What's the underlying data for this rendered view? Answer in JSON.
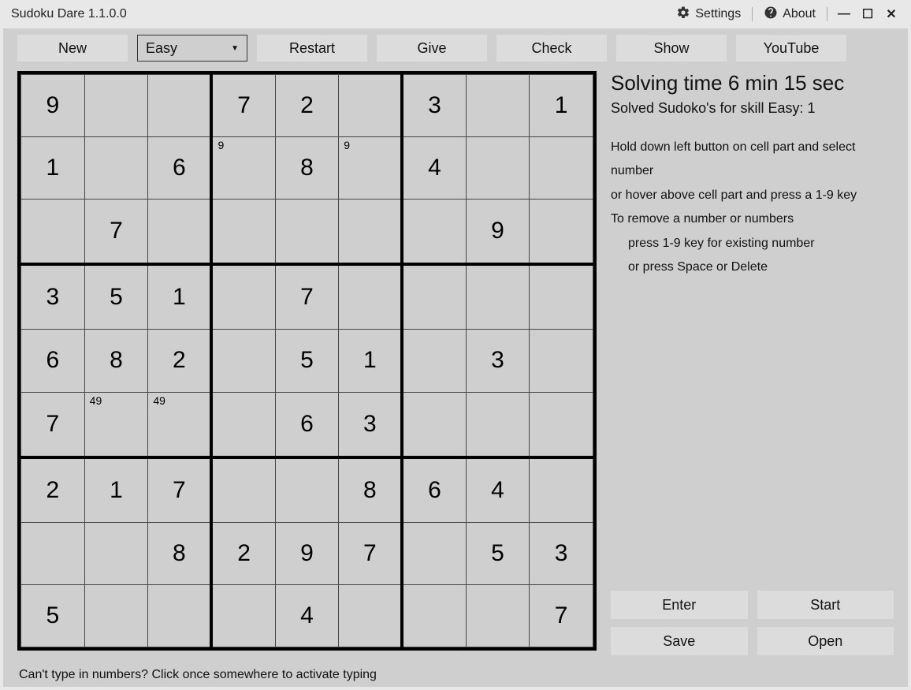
{
  "window": {
    "title": "Sudoku Dare 1.1.0.0",
    "settings_label": "Settings",
    "about_label": "About"
  },
  "toolbar": {
    "new_label": "New",
    "difficulty_selected": "Easy",
    "restart_label": "Restart",
    "give_label": "Give",
    "check_label": "Check",
    "show_label": "Show",
    "youtube_label": "YouTube"
  },
  "board": {
    "cells": [
      [
        {
          "v": "9"
        },
        {
          "v": ""
        },
        {
          "v": ""
        },
        {
          "v": "7"
        },
        {
          "v": "2"
        },
        {
          "v": ""
        },
        {
          "v": "3"
        },
        {
          "v": ""
        },
        {
          "v": "1"
        }
      ],
      [
        {
          "v": "1"
        },
        {
          "v": ""
        },
        {
          "v": "6"
        },
        {
          "v": "",
          "n": "9"
        },
        {
          "v": "8"
        },
        {
          "v": "",
          "n": "9"
        },
        {
          "v": "4"
        },
        {
          "v": ""
        },
        {
          "v": ""
        }
      ],
      [
        {
          "v": ""
        },
        {
          "v": "7"
        },
        {
          "v": ""
        },
        {
          "v": ""
        },
        {
          "v": ""
        },
        {
          "v": ""
        },
        {
          "v": ""
        },
        {
          "v": "9"
        },
        {
          "v": ""
        }
      ],
      [
        {
          "v": "3"
        },
        {
          "v": "5"
        },
        {
          "v": "1"
        },
        {
          "v": ""
        },
        {
          "v": "7"
        },
        {
          "v": ""
        },
        {
          "v": ""
        },
        {
          "v": ""
        },
        {
          "v": ""
        }
      ],
      [
        {
          "v": "6"
        },
        {
          "v": "8"
        },
        {
          "v": "2"
        },
        {
          "v": ""
        },
        {
          "v": "5"
        },
        {
          "v": "1"
        },
        {
          "v": ""
        },
        {
          "v": "3"
        },
        {
          "v": ""
        }
      ],
      [
        {
          "v": "7"
        },
        {
          "v": "",
          "n": "49"
        },
        {
          "v": "",
          "n": "49"
        },
        {
          "v": ""
        },
        {
          "v": "6"
        },
        {
          "v": "3"
        },
        {
          "v": ""
        },
        {
          "v": ""
        },
        {
          "v": ""
        }
      ],
      [
        {
          "v": "2"
        },
        {
          "v": "1"
        },
        {
          "v": "7"
        },
        {
          "v": ""
        },
        {
          "v": ""
        },
        {
          "v": "8"
        },
        {
          "v": "6"
        },
        {
          "v": "4"
        },
        {
          "v": ""
        }
      ],
      [
        {
          "v": ""
        },
        {
          "v": ""
        },
        {
          "v": "8"
        },
        {
          "v": "2"
        },
        {
          "v": "9"
        },
        {
          "v": "7"
        },
        {
          "v": ""
        },
        {
          "v": "5"
        },
        {
          "v": "3"
        }
      ],
      [
        {
          "v": "5"
        },
        {
          "v": ""
        },
        {
          "v": ""
        },
        {
          "v": ""
        },
        {
          "v": "4"
        },
        {
          "v": ""
        },
        {
          "v": ""
        },
        {
          "v": ""
        },
        {
          "v": "7"
        }
      ]
    ]
  },
  "side": {
    "solving_time": "Solving time 6 min 15 sec",
    "solved_count": "Solved Sudoko's for skill Easy: 1",
    "hint1": "Hold down left button on cell part and select number",
    "hint2": "or hover above cell part and press a 1-9 key",
    "hint3": "To remove a number or numbers",
    "hint4": "press 1-9 key for existing number",
    "hint5": "or press Space or Delete",
    "enter_label": "Enter",
    "start_label": "Start",
    "save_label": "Save",
    "open_label": "Open"
  },
  "footer": {
    "tip": "Can't type in numbers? Click once somewhere to activate typing"
  }
}
